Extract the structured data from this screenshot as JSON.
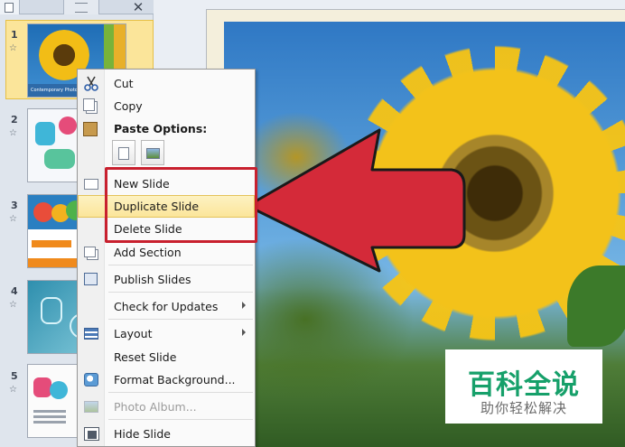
{
  "thumbnails": {
    "pane_close": "✕",
    "items": [
      {
        "num": "1",
        "caption": "Contemporary Photo"
      },
      {
        "num": "2"
      },
      {
        "num": "3"
      },
      {
        "num": "4"
      },
      {
        "num": "5"
      }
    ],
    "transition_mark": "☆"
  },
  "context_menu": {
    "cut": "Cut",
    "copy": "Copy",
    "paste_options": "Paste Options:",
    "new_slide": "New Slide",
    "duplicate_slide": "Duplicate Slide",
    "delete_slide": "Delete Slide",
    "add_section": "Add Section",
    "publish_slides": "Publish Slides",
    "check_for_updates": "Check for Updates",
    "layout": "Layout",
    "reset_slide": "Reset Slide",
    "format_background": "Format Background...",
    "photo_album": "Photo Album...",
    "hide_slide": "Hide Slide",
    "highlighted_item": "duplicate_slide"
  },
  "watermark": {
    "title": "百科全说",
    "subtitle": "助你轻松解决"
  },
  "colors": {
    "highlight_box": "#c8202e",
    "arrow_fill": "#d42a39",
    "watermark_green": "#16a06a"
  }
}
